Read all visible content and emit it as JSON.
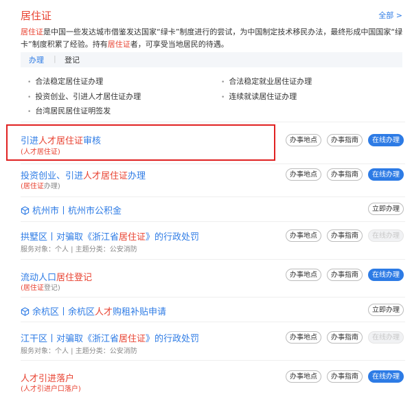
{
  "header": {
    "title": "居住证",
    "more": "全部 >"
  },
  "description": {
    "p1_hl": "居住证",
    "p1": "是中国一些发达城市借鉴发达国家“绿卡”制度进行的尝试，为中国制定技术移民办法，最终形成中国国家“绿卡”制度积累了经验。持有",
    "p2_hl": "居住证",
    "p2": "者，可享受当地居民的待遇。"
  },
  "tabs": {
    "active": "办理",
    "inactive": "登记",
    "separator": "|"
  },
  "subitems": [
    "合法稳定居住证办理",
    "合法稳定就业居住证办理",
    "投资创业、引进人才居住证办理",
    "连续就读居住证办理",
    "台湾居民居住证明签发"
  ],
  "rows": [
    {
      "t1": "引进",
      "t2": "人才居住证",
      "t3": "审核",
      "s1": "(人才居住证)",
      "s2": "",
      "b1": "办事地点",
      "b2": "办事指南",
      "b3": "在线办理"
    },
    {
      "t1": "投资创业、引进",
      "t2": "人才居住证",
      "t3": "办理",
      "s1": "(居住证",
      "s2": "办理)",
      "b1": "办事地点",
      "b2": "办事指南",
      "b3": "在线办理"
    },
    {
      "t1": "杭州市丨杭州市公积金",
      "btn": "立即办理"
    },
    {
      "t1": "拱墅区丨对骗取《浙江省",
      "t2": "居住证",
      "t3": "》的行政处罚",
      "s2": "服务对象：个人  |  主题分类：公安消防",
      "b1": "办事地点",
      "b2": "办事指南",
      "b3": "在线办理"
    },
    {
      "t1": "流动人口",
      "t2": "居住登记",
      "t3": "",
      "s1": "(居住证",
      "s2": "登记)",
      "b1": "办事地点",
      "b2": "办事指南",
      "b3": "在线办理"
    },
    {
      "t1": "余杭区丨余杭区",
      "t2": "人才",
      "t3": "购租补贴申请",
      "btn": "立即办理"
    },
    {
      "t1": "江干区丨对骗取《浙江省",
      "t2": "居住证",
      "t3": "》的行政处罚",
      "s2": "服务对象：个人  |  主题分类：公安消防",
      "b1": "办事地点",
      "b2": "办事指南",
      "b3": "在线办理"
    },
    {
      "t1": "",
      "t2": "人才引进落户",
      "t3": "",
      "s1": "(人才引进户口落户)",
      "b1": "办事地点",
      "b2": "办事指南",
      "b3": "在线办理"
    }
  ],
  "colors": {
    "accent": "#2d7be5",
    "red": "#e8402f",
    "highlight_box": "#e02020"
  }
}
